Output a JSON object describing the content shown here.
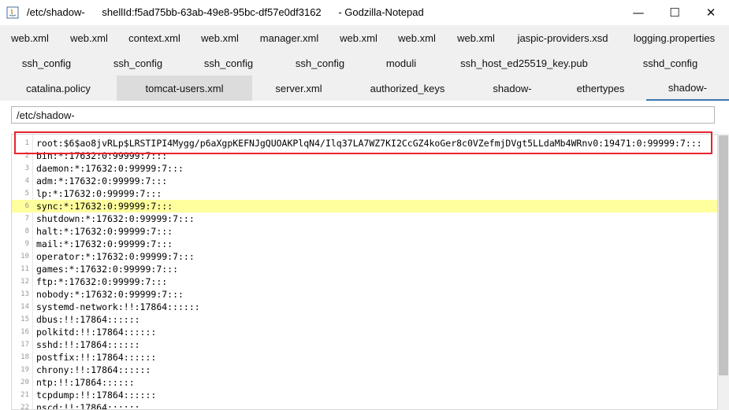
{
  "window": {
    "title": "/etc/shadow-      shellId:f5ad75bb-63ab-49e8-95bc-df57e0df3162      - Godzilla-Notepad",
    "minimize_glyph": "—",
    "maximize_glyph": "☐",
    "close_glyph": "✕"
  },
  "tabs": {
    "row1": [
      "web.xml",
      "web.xml",
      "context.xml",
      "web.xml",
      "manager.xml",
      "web.xml",
      "web.xml",
      "web.xml",
      "jaspic-providers.xsd",
      "logging.properties"
    ],
    "row2": [
      "ssh_config",
      "ssh_config",
      "ssh_config",
      "ssh_config",
      "moduli",
      "ssh_host_ed25519_key.pub",
      "sshd_config"
    ],
    "row3": [
      "catalina.policy",
      "tomcat-users.xml",
      "server.xml",
      "authorized_keys",
      "shadow-",
      "ethertypes",
      "shadow-"
    ]
  },
  "path": {
    "value": "/etc/shadow-"
  },
  "editor": {
    "lines": [
      "root:$6$ao8jvRLp$LRSTIPI4Mygg/p6aXgpKEFNJgQUOAKPlqN4/Ilq37LA7WZ7KI2CcGZ4koGer8c0VZefmjDVgt5LLdaMb4WRnv0:19471:0:99999:7:::",
      "bin:*:17632:0:99999:7:::",
      "daemon:*:17632:0:99999:7:::",
      "adm:*:17632:0:99999:7:::",
      "lp:*:17632:0:99999:7:::",
      "sync:*:17632:0:99999:7:::",
      "shutdown:*:17632:0:99999:7:::",
      "halt:*:17632:0:99999:7:::",
      "mail:*:17632:0:99999:7:::",
      "operator:*:17632:0:99999:7:::",
      "games:*:17632:0:99999:7:::",
      "ftp:*:17632:0:99999:7:::",
      "nobody:*:17632:0:99999:7:::",
      "systemd-network:!!:17864::::::",
      "dbus:!!:17864::::::",
      "polkitd:!!:17864::::::",
      "sshd:!!:17864::::::",
      "postfix:!!:17864::::::",
      "chrony:!!:17864::::::",
      "ntp:!!:17864::::::",
      "tcpdump:!!:17864::::::",
      "nscd:!!:17864::::::"
    ],
    "highlighted_line": 6
  },
  "colors": {
    "highlight": "#ffff9e",
    "annotation_box": "#e8242f",
    "selected_tab": "#dcdcdc",
    "active_tab_underline": "#3c78b4"
  }
}
